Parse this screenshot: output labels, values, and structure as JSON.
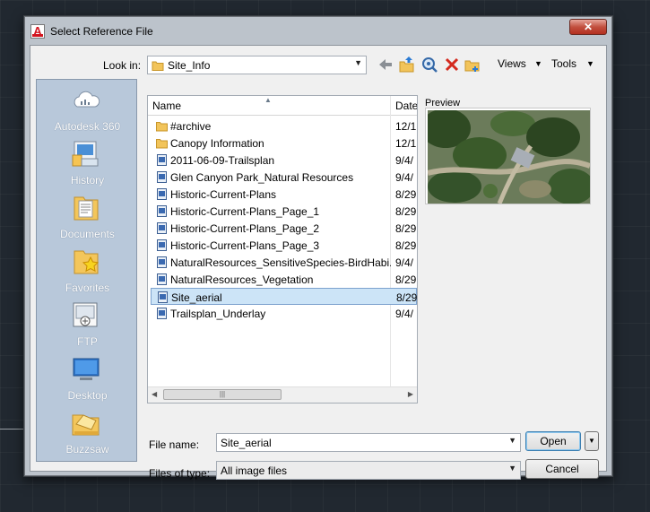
{
  "dialog": {
    "title": "Select Reference File",
    "close_label": "✕"
  },
  "toolbar": {
    "look_in_label": "Look in:",
    "look_in_value": "Site_Info",
    "views_label": "Views",
    "tools_label": "Tools"
  },
  "places": [
    {
      "label": "Autodesk 360",
      "icon": "cloud-icon"
    },
    {
      "label": "History",
      "icon": "history-icon"
    },
    {
      "label": "Documents",
      "icon": "documents-icon"
    },
    {
      "label": "Favorites",
      "icon": "favorites-icon"
    },
    {
      "label": "FTP",
      "icon": "ftp-icon"
    },
    {
      "label": "Desktop",
      "icon": "desktop-icon"
    },
    {
      "label": "Buzzsaw",
      "icon": "buzzsaw-icon"
    }
  ],
  "filelist": {
    "columns": {
      "name": "Name",
      "date": "Date"
    },
    "rows": [
      {
        "name": "#archive",
        "date": "12/1",
        "type": "folder"
      },
      {
        "name": "Canopy Information",
        "date": "12/1",
        "type": "folder"
      },
      {
        "name": "2011-06-09-Trailsplan",
        "date": "9/4/",
        "type": "file"
      },
      {
        "name": "Glen Canyon Park_Natural Resources",
        "date": "9/4/",
        "type": "file"
      },
      {
        "name": "Historic-Current-Plans",
        "date": "8/29",
        "type": "file"
      },
      {
        "name": "Historic-Current-Plans_Page_1",
        "date": "8/29",
        "type": "file"
      },
      {
        "name": "Historic-Current-Plans_Page_2",
        "date": "8/29",
        "type": "file"
      },
      {
        "name": "Historic-Current-Plans_Page_3",
        "date": "8/29",
        "type": "file"
      },
      {
        "name": "NaturalResources_SensitiveSpecies-BirdHabi...",
        "date": "9/4/",
        "type": "file"
      },
      {
        "name": "NaturalResources_Vegetation",
        "date": "8/29",
        "type": "file"
      },
      {
        "name": "Site_aerial",
        "date": "8/29",
        "type": "file",
        "selected": true
      },
      {
        "name": "Trailsplan_Underlay",
        "date": "9/4/",
        "type": "file"
      }
    ]
  },
  "preview": {
    "label": "Preview"
  },
  "form": {
    "file_name_label": "File name:",
    "file_name_value": "Site_aerial",
    "files_of_type_label": "Files of type:",
    "files_of_type_value": "All image files",
    "open_label": "Open",
    "cancel_label": "Cancel"
  }
}
